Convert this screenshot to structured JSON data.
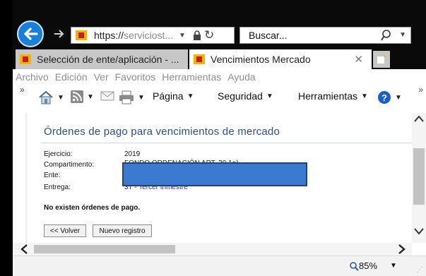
{
  "browser": {
    "url_visible": "https://",
    "url_host_truncated": "serviciost...",
    "search_placeholder": "Buscar...",
    "tabs": [
      {
        "label": "Selección de ente/aplicación - ..."
      },
      {
        "label": "Vencimientos Mercado"
      }
    ],
    "menu": [
      "Archivo",
      "Edición",
      "Ver",
      "Favoritos",
      "Herramientas",
      "Ayuda"
    ],
    "commands": {
      "page": "Página",
      "security": "Seguridad",
      "tools": "Herramientas"
    },
    "zoom": "85%"
  },
  "page": {
    "title": "Órdenes de pago para vencimientos de mercado",
    "fields": [
      {
        "label": "Ejercicio:",
        "value": "2019"
      },
      {
        "label": "Compartimento:",
        "value": "FONDO ORDENACIÓN ART. 39.1a)"
      },
      {
        "label": "Ente:",
        "value": ""
      },
      {
        "label": "Entrega:",
        "value": "3T - Tercer trimestre"
      }
    ],
    "empty_message": "No existen órdenes de pago.",
    "buttons": {
      "back": "<< Volver",
      "new_record": "Nuevo registro"
    }
  },
  "colors": {
    "title": "#2b4f8a",
    "link": "#2222cc",
    "redaction": "#3b7ad0",
    "back_button": "#1a7fd8"
  }
}
